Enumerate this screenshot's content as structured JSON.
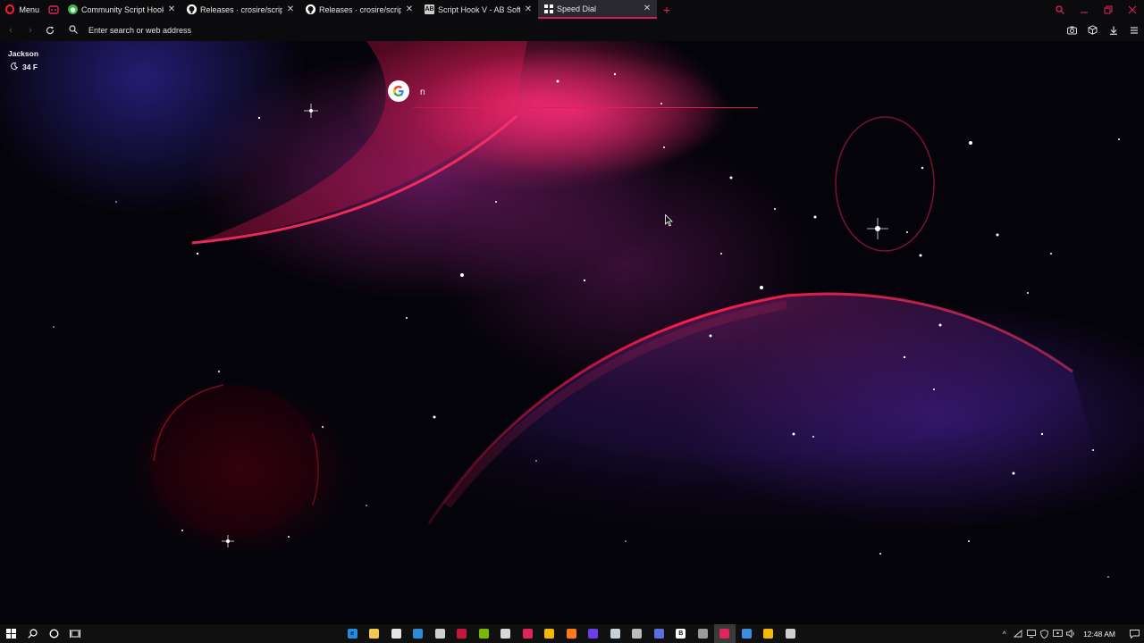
{
  "browser": {
    "menu_label": "Menu",
    "tabs": [
      {
        "title": "Community Script Hook V",
        "icon": "community-favicon-green",
        "color": "#3ab44a",
        "active": false
      },
      {
        "title": "Releases · crosire/scripthook",
        "icon": "github-icon",
        "color": "#ffffff",
        "active": false
      },
      {
        "title": "Releases · crosire/scripthook",
        "icon": "github-icon",
        "color": "#ffffff",
        "active": false
      },
      {
        "title": "Script Hook V - AB Software",
        "icon": "ab-software-icon",
        "color": "#cccccc",
        "active": false
      },
      {
        "title": "Speed Dial",
        "icon": "speed-dial-grid-icon",
        "color": "#ffffff",
        "active": true
      }
    ],
    "address_placeholder": "Enter search or web address",
    "accent_color": "#e0245e"
  },
  "weather": {
    "city": "Jackson",
    "temperature": "34 F",
    "icon": "moon-icon"
  },
  "speed_dial_search": {
    "engine": "Google",
    "value": "n"
  },
  "taskbar": {
    "apps": [
      {
        "name": "edge",
        "color": "#1f8de0",
        "glyph": "e"
      },
      {
        "name": "file-explorer",
        "color": "#f2c94c",
        "glyph": ""
      },
      {
        "name": "store",
        "color": "#e5e5e5",
        "glyph": ""
      },
      {
        "name": "mail",
        "color": "#2b8cd8",
        "glyph": ""
      },
      {
        "name": "xbox",
        "color": "#cfcfcf",
        "glyph": ""
      },
      {
        "name": "app-red",
        "color": "#c3183c",
        "glyph": ""
      },
      {
        "name": "nvidia",
        "color": "#76b900",
        "glyph": ""
      },
      {
        "name": "drop",
        "color": "#d8d8d8",
        "glyph": ""
      },
      {
        "name": "opera-gx",
        "color": "#e0245e",
        "glyph": ""
      },
      {
        "name": "app-yellow",
        "color": "#f5b800",
        "glyph": ""
      },
      {
        "name": "firefox",
        "color": "#ff7a18",
        "glyph": ""
      },
      {
        "name": "app-red-blue",
        "color": "#6a3de8",
        "glyph": ""
      },
      {
        "name": "steam",
        "color": "#c8d0da",
        "glyph": ""
      },
      {
        "name": "obs",
        "color": "#bbbbbb",
        "glyph": ""
      },
      {
        "name": "app-blue",
        "color": "#5a70e0",
        "glyph": ""
      },
      {
        "name": "bbedit",
        "color": "#ffffff",
        "glyph": "B"
      },
      {
        "name": "app-gray",
        "color": "#9a9a9a",
        "glyph": ""
      },
      {
        "name": "opera-gx-active",
        "color": "#e0245e",
        "glyph": ""
      },
      {
        "name": "app-window",
        "color": "#3b8de0",
        "glyph": ""
      },
      {
        "name": "app-yellow-2",
        "color": "#f5b800",
        "glyph": ""
      },
      {
        "name": "settings",
        "color": "#cfcfcf",
        "glyph": ""
      }
    ],
    "clock": "12:48 AM"
  }
}
